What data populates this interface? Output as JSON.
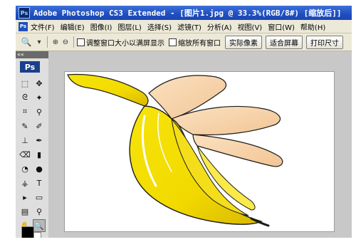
{
  "titlebar": {
    "app_badge": "Ps",
    "title": "Adobe Photoshop CS3 Extended - [图片1.jpg @ 33.3%(RGB/8#) [缩放后]]"
  },
  "menubar": {
    "logo": "Ps",
    "items": [
      {
        "label": "文件(F)"
      },
      {
        "label": "编辑(E)"
      },
      {
        "label": "图像(I)"
      },
      {
        "label": "图层(L)"
      },
      {
        "label": "选择(S)"
      },
      {
        "label": "滤镜(T)"
      },
      {
        "label": "分析(A)"
      },
      {
        "label": "视图(V)"
      },
      {
        "label": "窗口(W)"
      },
      {
        "label": "帮助(H)"
      }
    ]
  },
  "options": {
    "tool_icon": "zoom-icon",
    "tool_glyph": "🔍",
    "dropdown_glyph": "▾",
    "zoom_in_glyph": "⊕",
    "zoom_out_glyph": "⊖",
    "check_resize": "调整窗口大小以满屏显示",
    "check_zoom_all": "缩放所有窗口",
    "btn_actual": "实际像素",
    "btn_fit": "适合屏幕",
    "btn_print": "打印尺寸"
  },
  "toolbox": {
    "collapse": "««",
    "logo": "Ps",
    "tools": [
      {
        "name": "marquee-icon",
        "glyph": "⬚"
      },
      {
        "name": "move-icon",
        "glyph": "✥"
      },
      {
        "name": "lasso-icon",
        "glyph": "ᘓ"
      },
      {
        "name": "magic-wand-icon",
        "glyph": "✦"
      },
      {
        "name": "crop-icon",
        "glyph": "⌗"
      },
      {
        "name": "eyedropper-icon",
        "glyph": "⚲"
      },
      {
        "name": "healing-icon",
        "glyph": "✎"
      },
      {
        "name": "brush-icon",
        "glyph": "✐"
      },
      {
        "name": "stamp-icon",
        "glyph": "⊥"
      },
      {
        "name": "history-brush-icon",
        "glyph": "✒"
      },
      {
        "name": "eraser-icon",
        "glyph": "⌫"
      },
      {
        "name": "gradient-icon",
        "glyph": "▮"
      },
      {
        "name": "blur-icon",
        "glyph": "◔"
      },
      {
        "name": "dodge-icon",
        "glyph": "●"
      },
      {
        "name": "pen-icon",
        "glyph": "⚶"
      },
      {
        "name": "type-icon",
        "glyph": "T"
      },
      {
        "name": "path-select-icon",
        "glyph": "▸"
      },
      {
        "name": "shape-icon",
        "glyph": "▭"
      },
      {
        "name": "notes-icon",
        "glyph": "▤"
      },
      {
        "name": "eyedropper2-icon",
        "glyph": "⚲"
      },
      {
        "name": "hand-icon",
        "glyph": "✋"
      },
      {
        "name": "zoom-tool-icon",
        "glyph": "🔍",
        "active": true
      }
    ]
  },
  "canvas": {
    "background": "#c8c8c8"
  }
}
